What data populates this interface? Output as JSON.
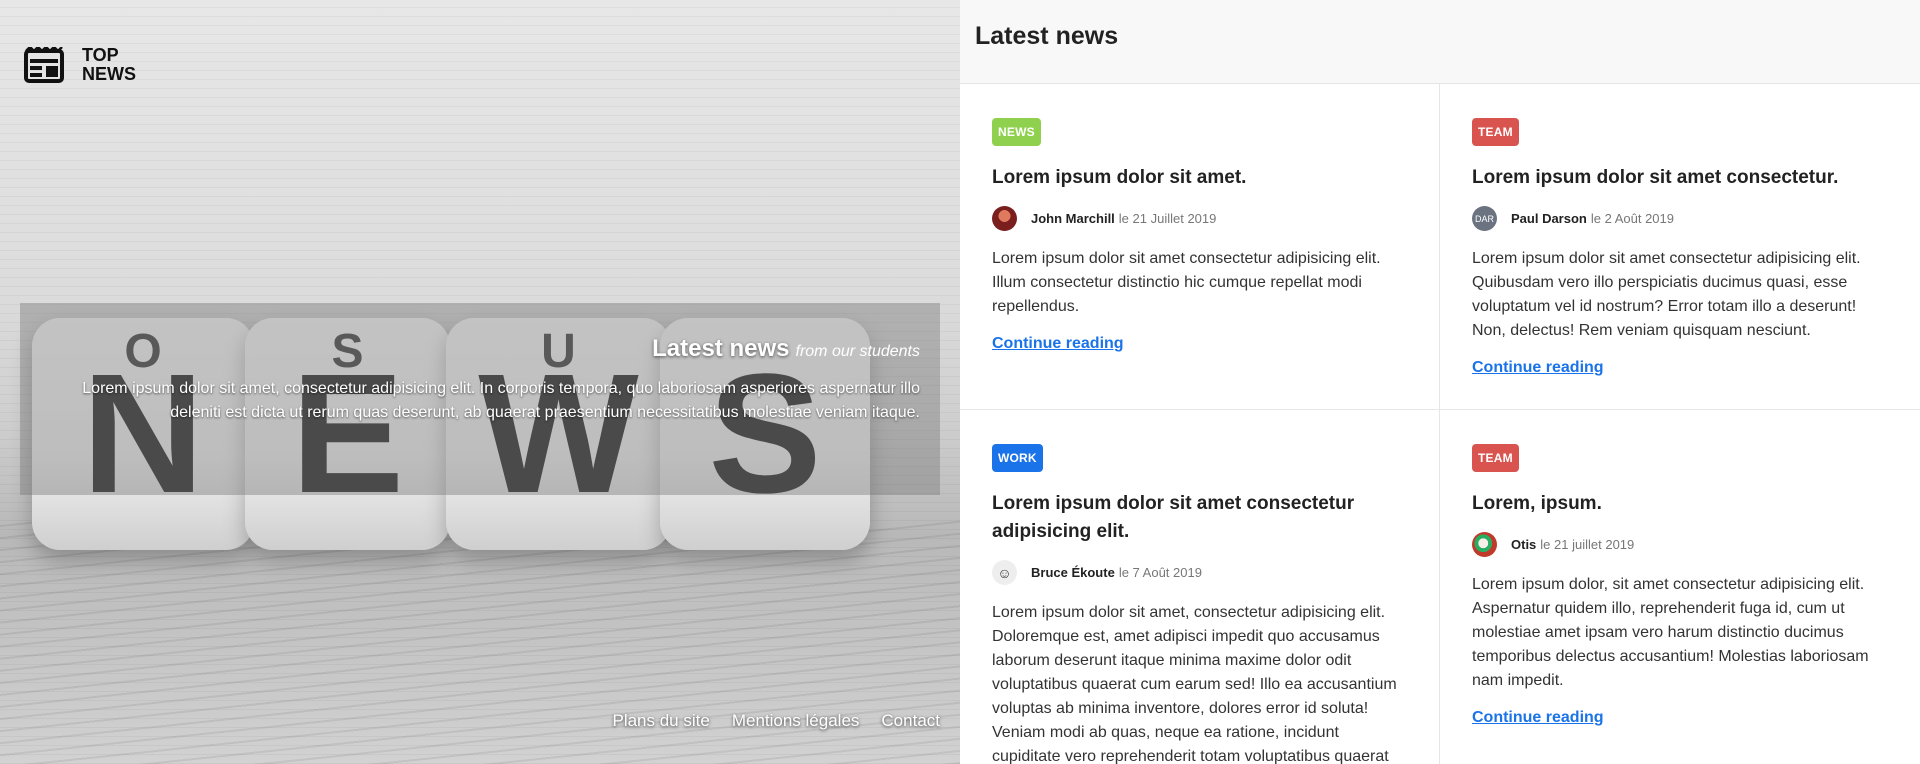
{
  "logo": {
    "line1": "TOP",
    "line2": "NEWS",
    "icon": "newspaper-icon"
  },
  "hero": {
    "dice_letters": [
      "N",
      "E",
      "W",
      "S"
    ],
    "dice_top_letters": [
      "O",
      "S",
      "U",
      ""
    ],
    "title": "Latest news",
    "subtitle": "from our students",
    "text": "Lorem ipsum dolor sit amet, consectetur adipisicing elit. In corporis tempora, quo laboriosam asperiores aspernatur illo deleniti est dicta ut rerum quas deserunt, ab quaerat praesentium necessitatibus molestiae veniam itaque.",
    "footer_links": [
      "Plans du site",
      "Mentions légales",
      "Contact"
    ]
  },
  "panel": {
    "title": "Latest news",
    "cards": [
      {
        "badge": "NEWS",
        "badge_color": "#8fd14f",
        "title": "Lorem ipsum dolor sit amet.",
        "author": "John Marchill",
        "date": "le 21 Juillet 2019",
        "avatar_color": "#b3261e",
        "avatar_label": "",
        "text": "Lorem ipsum dolor sit amet consectetur adipisicing elit. Illum consectetur distinctio hic cumque repellat modi repellendus.",
        "link": "Continue reading"
      },
      {
        "badge": "TEAM",
        "badge_color": "#d9534f",
        "title": "Lorem ipsum dolor sit amet consectetur.",
        "author": "Paul Darson",
        "date": "le 2 Août 2019",
        "avatar_color": "#6b7280",
        "avatar_label": "DAR",
        "text": "Lorem ipsum dolor sit amet consectetur adipisicing elit. Quibusdam vero illo perspiciatis ducimus quasi, esse voluptatum vel id nostrum? Error totam illo a deserunt! Non, delectus! Rem veniam quisquam nesciunt.",
        "link": "Continue reading"
      },
      {
        "badge": "WORK",
        "badge_color": "#1a73e8",
        "title": "Lorem ipsum dolor sit amet consectetur adipisicing elit.",
        "author": "Bruce Ékoute",
        "date": "le 7 Août 2019",
        "avatar_color": "#e5e5e5",
        "avatar_label": "",
        "text": "Lorem ipsum dolor sit amet, consectetur adipisicing elit. Doloremque est, amet adipisci impedit quo accusamus laborum deserunt itaque minima maxime dolor odit voluptatibus quaerat cum earum sed! Illo ea accusantium voluptas ab minima inventore, dolores error id soluta! Veniam modi ab quas, neque ea ratione, incidunt cupiditate vero reprehenderit totam voluptatibus quaerat",
        "link": ""
      },
      {
        "badge": "TEAM",
        "badge_color": "#d9534f",
        "title": "Lorem, ipsum.",
        "author": "Otis",
        "date": "le 21 juillet 2019",
        "avatar_color": "#c0392b",
        "avatar_label": "",
        "text": "Lorem ipsum dolor, sit amet consectetur adipisicing elit. Aspernatur quidem illo, reprehenderit fuga id, cum ut molestiae amet ipsam vero harum distinctio ducimus temporibus delectus accusantium! Molestias laboriosam nam impedit.",
        "link": "Continue reading"
      }
    ]
  }
}
